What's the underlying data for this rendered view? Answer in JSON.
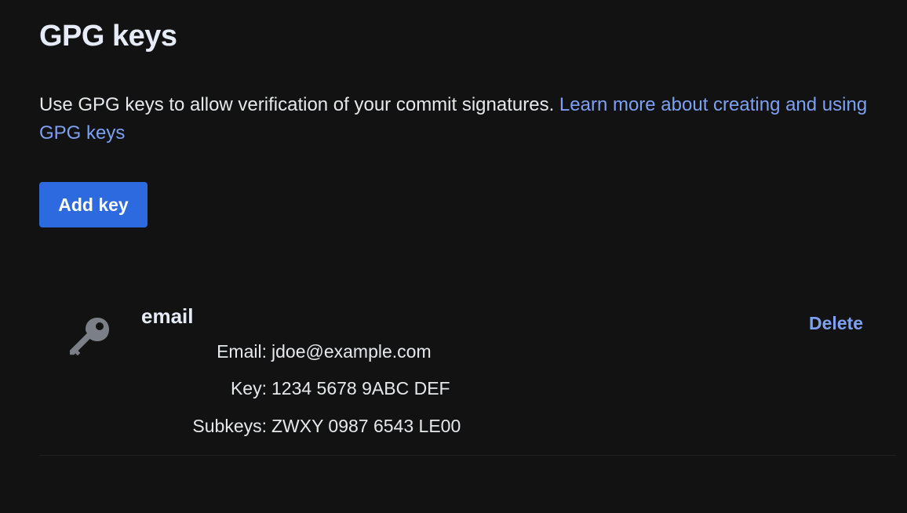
{
  "header": {
    "title": "GPG keys"
  },
  "intro": {
    "text": "Use GPG keys to allow verification of your commit signatures. ",
    "link_text": "Learn more about creating and using GPG keys"
  },
  "actions": {
    "add_label": "Add key"
  },
  "keys": [
    {
      "name": "email",
      "icon": "key-icon",
      "email_label": "Email:",
      "email_value": "jdoe@example.com",
      "key_label": "Key:",
      "key_value": "1234 5678 9ABC DEF",
      "subkeys_label": "Subkeys:",
      "subkeys_value": "ZWXY 0987 6543 LE00",
      "delete_label": "Delete"
    }
  ],
  "colors": {
    "background": "#121213",
    "accent_link": "#7da0f2",
    "primary_button": "#2d6ae0",
    "icon": "#7b7f87"
  }
}
